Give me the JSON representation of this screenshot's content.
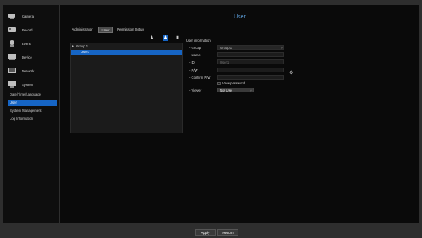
{
  "sidebar": {
    "items": [
      {
        "label": "Camera",
        "icon": "camera-icon"
      },
      {
        "label": "Record",
        "icon": "record-icon"
      },
      {
        "label": "Event",
        "icon": "event-icon"
      },
      {
        "label": "Device",
        "icon": "device-icon"
      },
      {
        "label": "Network",
        "icon": "network-icon"
      },
      {
        "label": "System",
        "icon": "system-icon"
      }
    ],
    "sub_items": [
      {
        "label": "Date/Time/Language"
      },
      {
        "label": "User"
      },
      {
        "label": "System Management"
      },
      {
        "label": "Log Information"
      }
    ]
  },
  "header": {
    "title": "User"
  },
  "tabs": [
    {
      "label": "Administrator"
    },
    {
      "label": "User"
    },
    {
      "label": "Permission Setup"
    }
  ],
  "tree": {
    "group": "Group 1",
    "user": "User1"
  },
  "user_info": {
    "heading": "User information",
    "labels": {
      "group": "- Group",
      "name": "- Name",
      "id": "- ID",
      "pw": "- P/W",
      "confirm_pw": "- Confirm P/W",
      "viewer": "- Viewer"
    },
    "group_value": "Group 1",
    "name_value": "",
    "id_value": "User1",
    "pw_value": "",
    "confirm_pw_value": "",
    "view_password_label": "View password",
    "viewer_value": "Not Use"
  },
  "footer": {
    "apply_label": "Apply",
    "return_label": "Return"
  },
  "colors": {
    "accent": "#1665c5",
    "title": "#5b9bd5"
  }
}
